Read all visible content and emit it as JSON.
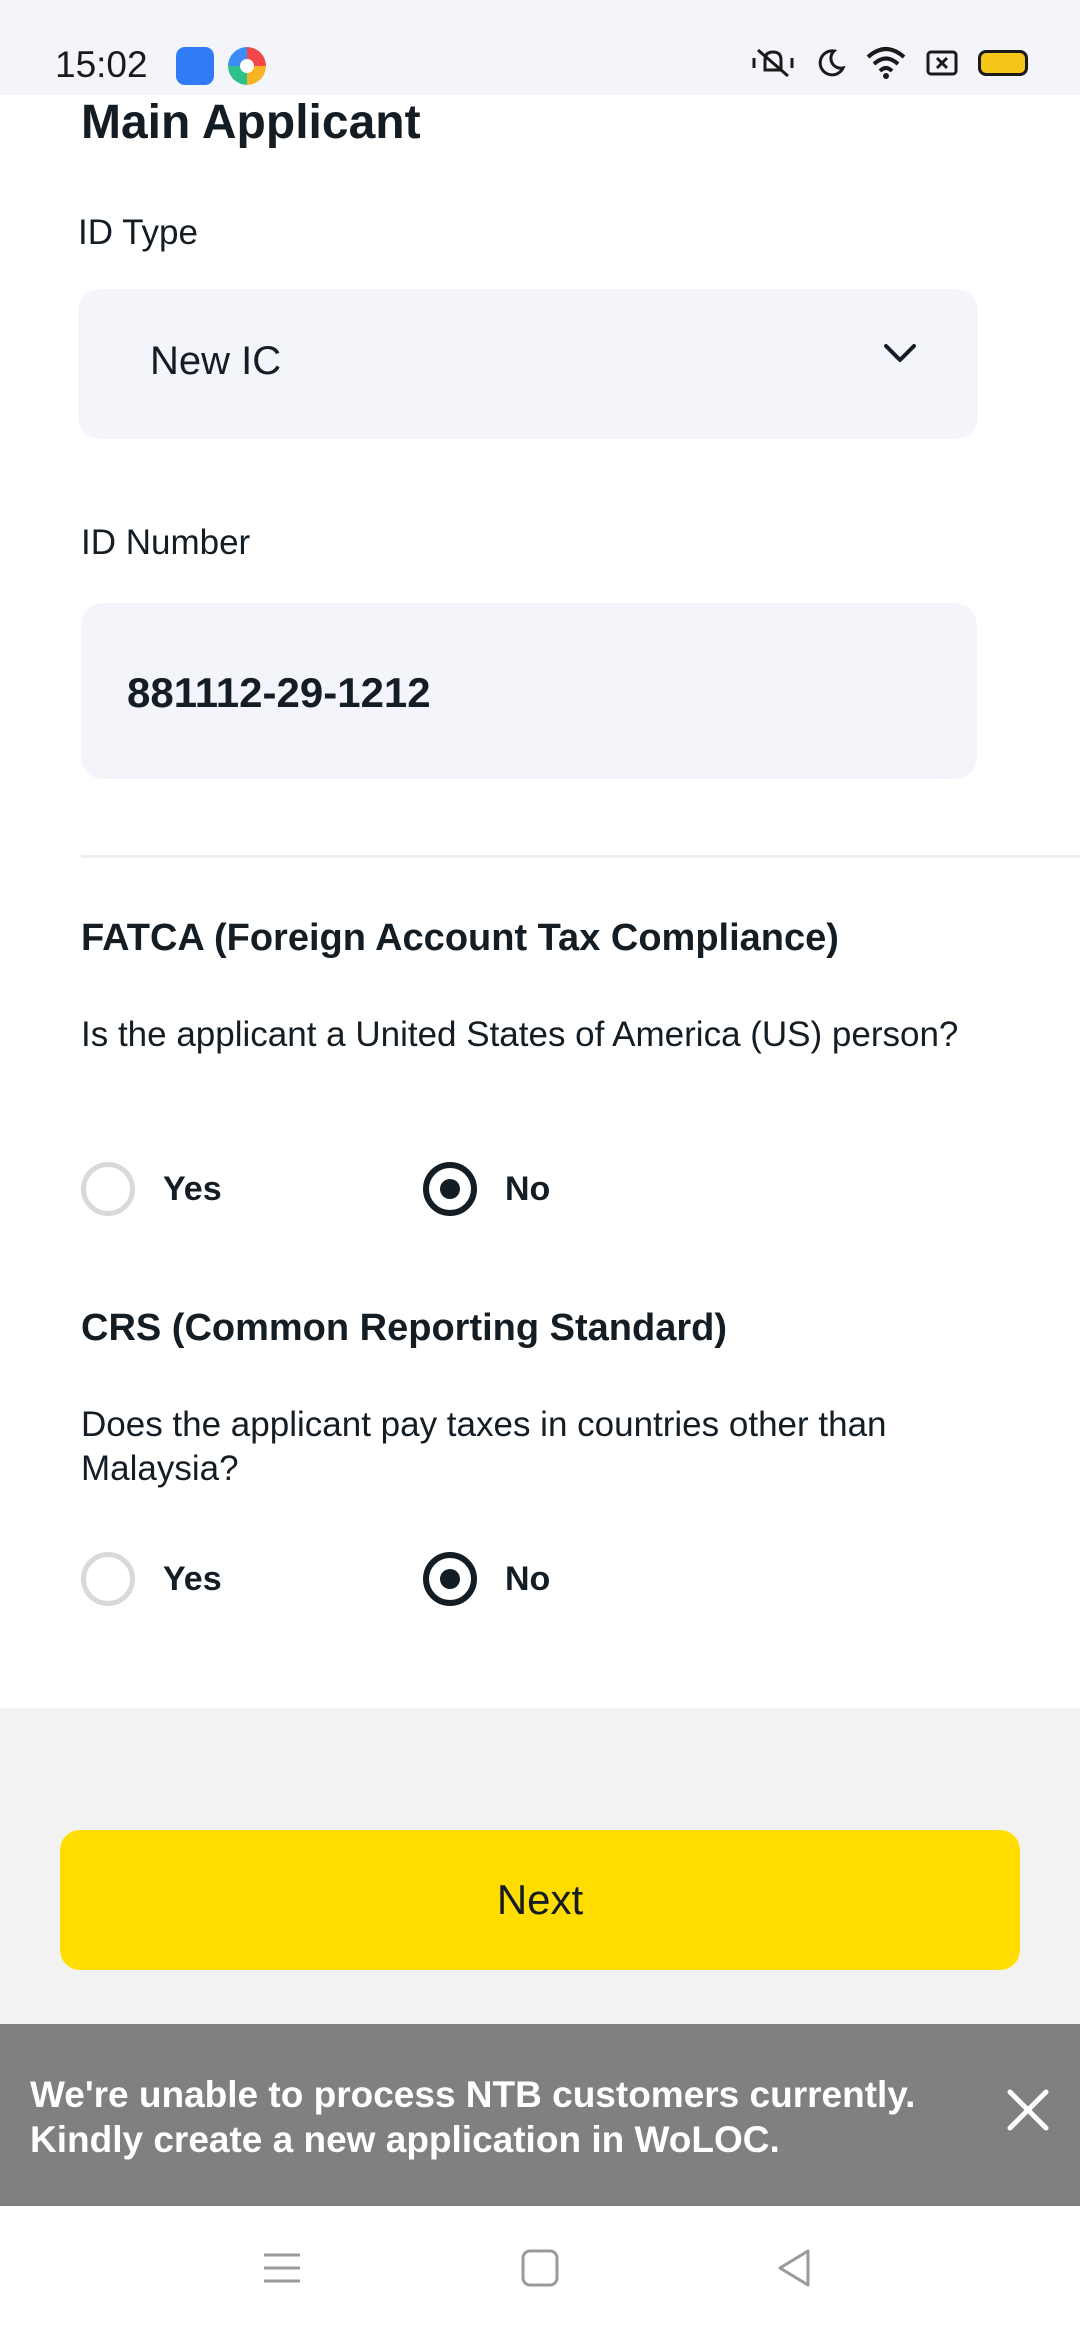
{
  "status_bar": {
    "time": "15:02",
    "icons": [
      "android-app-icon",
      "color-app-icon",
      "vibrate-muted-icon",
      "do-not-disturb-icon",
      "wifi-icon",
      "screen-record-icon",
      "battery-icon"
    ]
  },
  "form": {
    "section_title": "Main Applicant",
    "id_type": {
      "label": "ID Type",
      "value": "New IC"
    },
    "id_number": {
      "label": "ID Number",
      "value": "881112-29-1212"
    }
  },
  "fatca": {
    "title": "FATCA (Foreign Account Tax Compliance)",
    "question": "Is the applicant a United States of America (US) person?",
    "options": [
      "Yes",
      "No"
    ],
    "selected": "No"
  },
  "crs": {
    "title": "CRS (Common Reporting Standard)",
    "question": "Does the applicant pay taxes in countries other than Malaysia?",
    "options": [
      "Yes",
      "No"
    ],
    "selected": "No"
  },
  "footer": {
    "next_label": "Next"
  },
  "toast": {
    "message": "We're unable to process NTB customers currently. Kindly create a new application in WoLOC."
  },
  "nav_bar": {
    "buttons": [
      "menu-icon",
      "home-icon",
      "back-icon"
    ]
  },
  "colors": {
    "accent": "#ffdd00",
    "field_bg": "#f4f5fa",
    "toast_bg": "#808080",
    "text": "#141c24"
  }
}
